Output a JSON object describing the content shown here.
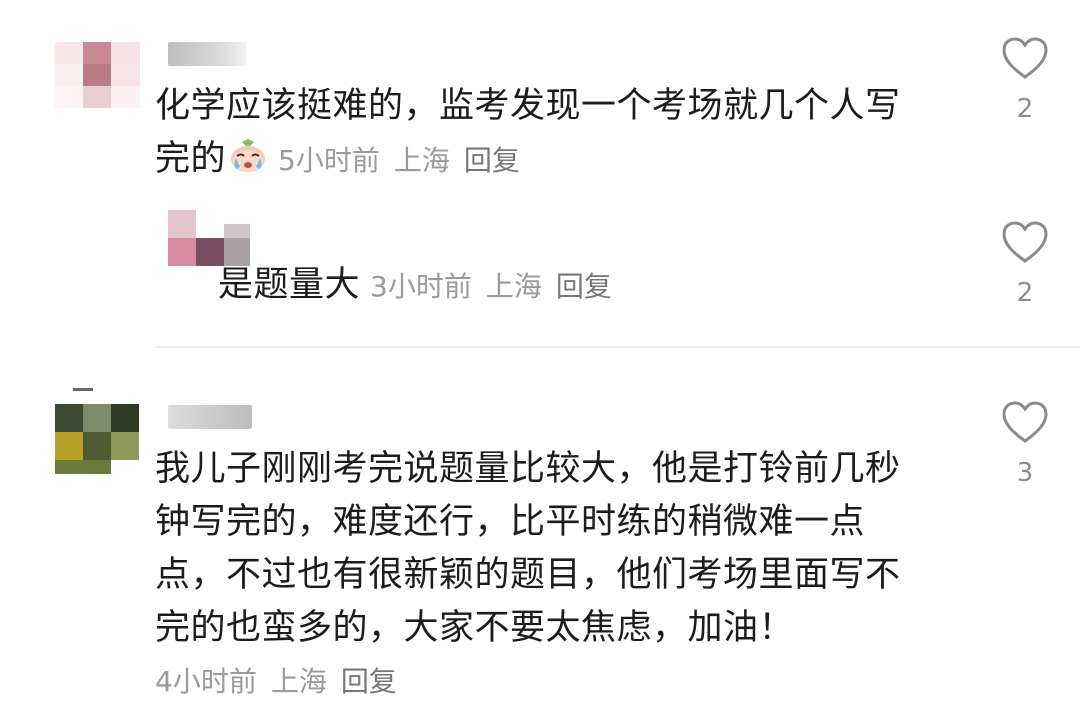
{
  "comments": [
    {
      "text_line1": "化学应该挺难的，监考发现一个考场就几个人写",
      "text_line2": "完的",
      "emoji": "crying-face-emoji",
      "time": "5小时前",
      "location": "上海",
      "reply_label": "回复",
      "likes": "2"
    },
    {
      "text": "是题量大",
      "time": "3小时前",
      "location": "上海",
      "reply_label": "回复",
      "likes": "2"
    },
    {
      "text_line1": "我儿子刚刚考完说题量比较大，他是打铃前几秒",
      "text_line2": "钟写完的，难度还行，比平时练的稍微难一点",
      "text_line3": "点，不过也有很新颖的题目，他们考场里面写不",
      "text_line4": "完的也蛮多的，大家不要太焦虑，加油！",
      "time": "4小时前",
      "location": "上海",
      "reply_label": "回复",
      "likes": "3"
    }
  ],
  "icons": {
    "like": "heart-outline-icon"
  },
  "colors": {
    "text": "#1c1c1c",
    "meta": "#9a9a9a",
    "like_count": "#8c8c8c",
    "divider": "#ececec"
  }
}
